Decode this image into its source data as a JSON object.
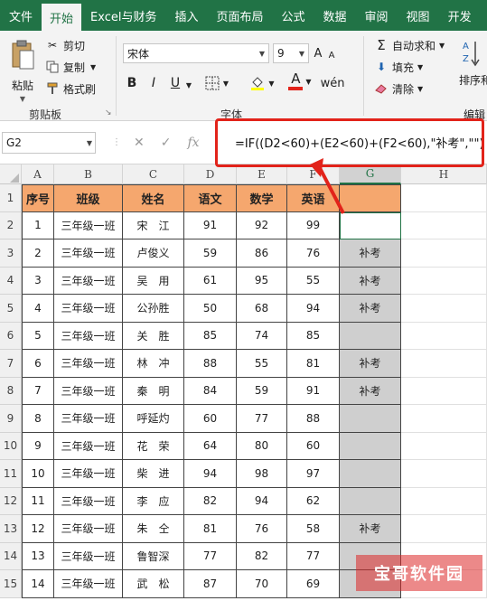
{
  "tabs": [
    "文件",
    "开始",
    "Excel与财务",
    "插入",
    "页面布局",
    "公式",
    "数据",
    "审阅",
    "视图",
    "开发"
  ],
  "active_tab_index": 1,
  "ribbon": {
    "clipboard": {
      "paste": "粘贴",
      "cut": "剪切",
      "copy": "复制",
      "format_painter": "格式刷",
      "group_label": "剪贴板"
    },
    "font": {
      "font_name": "宋体",
      "font_size": "9",
      "bold": "B",
      "italic": "I",
      "underline": "U",
      "font_color_letter": "A",
      "group_label": "字体"
    },
    "editing": {
      "autosum": "自动求和",
      "fill": "填充",
      "clear": "清除",
      "sort_filter": "排序和",
      "group_label": "编辑"
    }
  },
  "formula_bar": {
    "name_box": "G2",
    "fx": "fx",
    "formula": "=IF((D2<60)+(E2<60)+(F2<60),\"补考\",\"\")"
  },
  "columns": [
    "A",
    "B",
    "C",
    "D",
    "E",
    "F",
    "G",
    "H"
  ],
  "selected_column": "G",
  "header_row": [
    "序号",
    "班级",
    "姓名",
    "语文",
    "数学",
    "英语",
    ""
  ],
  "rows": [
    {
      "row": "2",
      "cells": [
        "1",
        "三年级一班",
        "宋　江",
        "91",
        "92",
        "99",
        ""
      ]
    },
    {
      "row": "3",
      "cells": [
        "2",
        "三年级一班",
        "卢俊义",
        "59",
        "86",
        "76",
        "补考"
      ]
    },
    {
      "row": "4",
      "cells": [
        "3",
        "三年级一班",
        "吴　用",
        "61",
        "95",
        "55",
        "补考"
      ]
    },
    {
      "row": "5",
      "cells": [
        "4",
        "三年级一班",
        "公孙胜",
        "50",
        "68",
        "94",
        "补考"
      ]
    },
    {
      "row": "6",
      "cells": [
        "5",
        "三年级一班",
        "关　胜",
        "85",
        "74",
        "85",
        ""
      ]
    },
    {
      "row": "7",
      "cells": [
        "6",
        "三年级一班",
        "林　冲",
        "88",
        "55",
        "81",
        "补考"
      ]
    },
    {
      "row": "8",
      "cells": [
        "7",
        "三年级一班",
        "秦　明",
        "84",
        "59",
        "91",
        "补考"
      ]
    },
    {
      "row": "9",
      "cells": [
        "8",
        "三年级一班",
        "呼延灼",
        "60",
        "77",
        "88",
        ""
      ]
    },
    {
      "row": "10",
      "cells": [
        "9",
        "三年级一班",
        "花　荣",
        "64",
        "80",
        "60",
        ""
      ]
    },
    {
      "row": "11",
      "cells": [
        "10",
        "三年级一班",
        "柴　进",
        "94",
        "98",
        "97",
        ""
      ]
    },
    {
      "row": "12",
      "cells": [
        "11",
        "三年级一班",
        "李　应",
        "82",
        "94",
        "62",
        ""
      ]
    },
    {
      "row": "13",
      "cells": [
        "12",
        "三年级一班",
        "朱　仝",
        "81",
        "76",
        "58",
        "补考"
      ]
    },
    {
      "row": "14",
      "cells": [
        "13",
        "三年级一班",
        "鲁智深",
        "77",
        "82",
        "77",
        ""
      ]
    },
    {
      "row": "15",
      "cells": [
        "14",
        "三年级一班",
        "武　松",
        "87",
        "70",
        "69",
        ""
      ]
    }
  ],
  "header_row_number": "1",
  "watermark": "宝哥软件园",
  "colors": {
    "excel_green": "#217346",
    "header_fill": "#f5a76e",
    "g_fill": "#cfcfcf",
    "highlight_red": "#e2231a"
  }
}
